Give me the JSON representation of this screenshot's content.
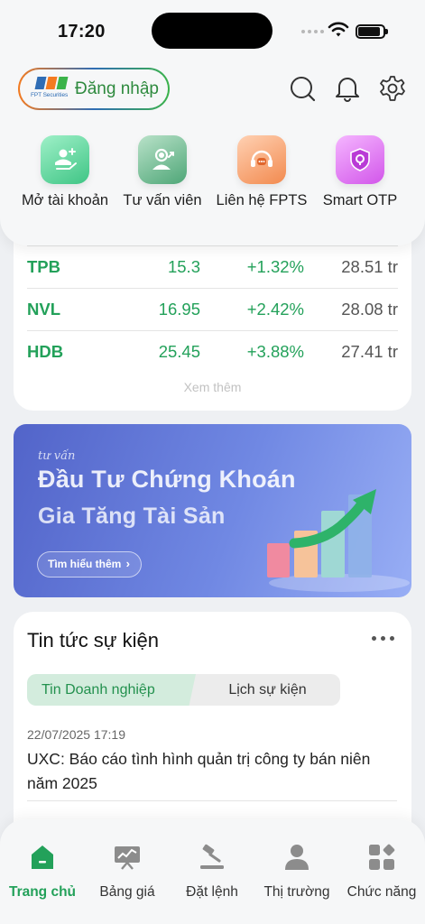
{
  "status_bar": {
    "time": "17:20"
  },
  "header": {
    "brand_text": "FPT Securities",
    "login_label": "Đăng nhập",
    "icons": [
      "search-icon",
      "bell-icon",
      "settings-icon"
    ]
  },
  "quick_actions": [
    {
      "label": "Mở tài khoản",
      "icon": "open-account-icon",
      "color": "#5fd39a"
    },
    {
      "label": "Tư vấn viên",
      "icon": "advisor-icon",
      "color": "#7cc39d"
    },
    {
      "label": "Liên hệ FPTS",
      "icon": "headset-icon",
      "color": "#f6a16f"
    },
    {
      "label": "Smart OTP",
      "icon": "shield-lock-icon",
      "color": "#e06ef0"
    }
  ],
  "stocks": [
    {
      "symbol": "TPB",
      "price": "15.3",
      "change": "+1.32%",
      "volume": "28.51 tr"
    },
    {
      "symbol": "NVL",
      "price": "16.95",
      "change": "+2.42%",
      "volume": "28.08 tr"
    },
    {
      "symbol": "HDB",
      "price": "25.45",
      "change": "+3.88%",
      "volume": "27.41 tr"
    }
  ],
  "see_more": "Xem thêm",
  "banner": {
    "script": "tư vấn",
    "line1": "Đầu Tư Chứng Khoán",
    "line2": "Gia Tăng Tài Sản",
    "button": "Tìm hiểu thêm",
    "button_chevron": "›"
  },
  "news": {
    "title": "Tin tức sự kiện",
    "tabs": [
      "Tin Doanh nghiệp",
      "Lịch sự kiện"
    ],
    "active_tab": "Tin Doanh nghiệp",
    "items": [
      {
        "time": "22/07/2025 17:19",
        "headline": "UXC: Báo cáo tình hình quản trị công ty bán niên năm 2025"
      }
    ]
  },
  "bottom_nav": [
    {
      "label": "Trang chủ",
      "icon": "home-icon",
      "active": true
    },
    {
      "label": "Bảng giá",
      "icon": "price-board-icon",
      "active": false
    },
    {
      "label": "Đặt lệnh",
      "icon": "gavel-icon",
      "active": false
    },
    {
      "label": "Thị trường",
      "icon": "market-icon",
      "active": false
    },
    {
      "label": "Chức năng",
      "icon": "apps-icon",
      "active": false
    }
  ],
  "colors": {
    "brand_green": "#23a15a",
    "banner_blue": "#5b6fd6"
  }
}
